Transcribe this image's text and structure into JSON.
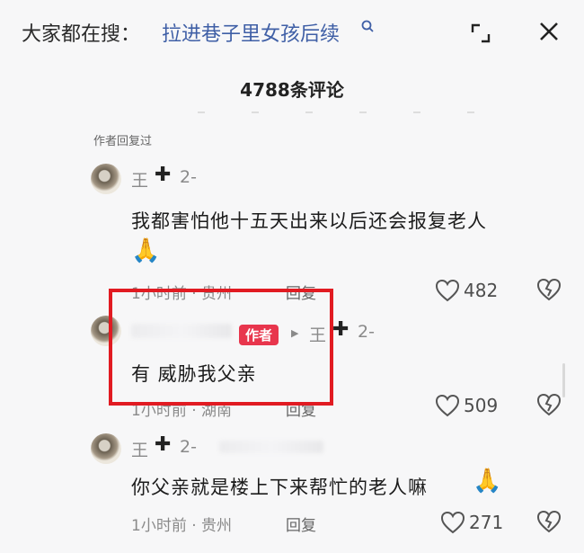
{
  "header": {
    "search_prefix": "大家都在搜：",
    "search_query": "拉进巷子里女孩后续",
    "comment_count": "4788条评论"
  },
  "replied_tag": "作者回复过",
  "comments": [
    {
      "name": "王",
      "level": "2-",
      "text": "我都害怕他十五天出来以后还会报复老人",
      "emoji": "🙏",
      "time_loc": "1小时前 · 贵州",
      "reply": "回复",
      "likes": "482"
    },
    {
      "author_badge": "作者",
      "reply_to": "王",
      "level": "2-",
      "text": "有 威胁我父亲",
      "time_loc": "1小时前 · 湖南",
      "reply": "回复",
      "likes": "509"
    },
    {
      "name": "王",
      "level": "2-",
      "text": "你父亲就是楼上下来帮忙的老人嘛",
      "emoji": "🙏",
      "time_loc": "1小时前 · 贵州",
      "reply": "回复",
      "likes": "271"
    }
  ],
  "icons": {
    "collapse": "collapse-icon",
    "close": "close-icon",
    "heart": "heart-icon",
    "dislike": "broken-heart-icon"
  },
  "colors": {
    "highlight": "#e11b22",
    "author_badge": "#e8364d",
    "search_link": "#3f5fa6"
  }
}
